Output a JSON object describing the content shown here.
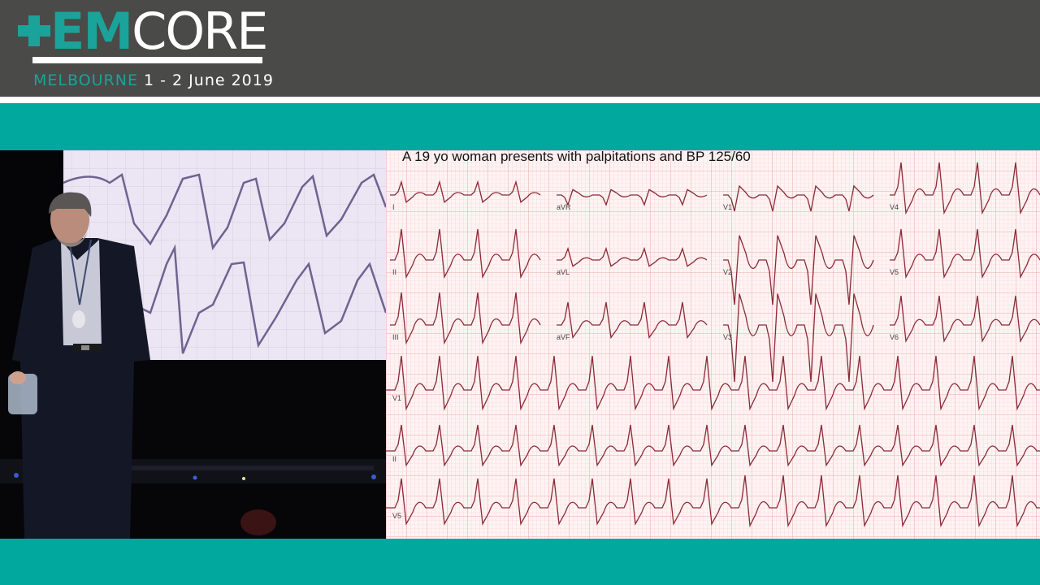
{
  "header": {
    "logo": {
      "em": "EM",
      "core": "CORE"
    },
    "event_city": "MELBOURNE",
    "event_date": "1 - 2 June 2019"
  },
  "slide": {
    "title": "A 19 yo woman presents with palpitations and BP 125/60",
    "leads": [
      "I",
      "aVR",
      "V1",
      "V4",
      "II",
      "aVL",
      "V2",
      "V5",
      "III",
      "aVF",
      "V3",
      "V6",
      "V1",
      "II",
      "V5"
    ]
  },
  "colors": {
    "header_bg": "#4a4a48",
    "teal": "#00a89e",
    "brand_teal": "#1aa39a",
    "ecg_paper": "#fff3f3",
    "ecg_grid": "#f2b8b8",
    "ecg_trace": "#8a2a36"
  }
}
